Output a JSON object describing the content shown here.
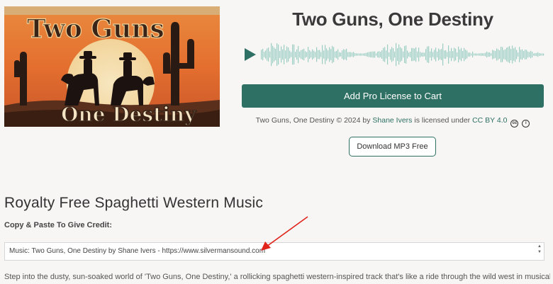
{
  "cover": {
    "title_line1": "Two Guns",
    "title_line2": "One Destiny"
  },
  "player": {
    "title": "Two Guns, One Destiny",
    "accent_color": "#2f7064",
    "waveform_color": "#9ccdc2",
    "play_icon": "play-icon"
  },
  "actions": {
    "cart_label": "Add Pro License to Cart",
    "download_label": "Download MP3 Free"
  },
  "license": {
    "prefix": "Two Guns, One Destiny © 2024 by",
    "author": "Shane Ivers",
    "middle": "is licensed under",
    "license_name": "CC BY 4.0",
    "cc_icon": "cc",
    "by_icon": "i"
  },
  "section": {
    "heading": "Royalty Free Spaghetti Western Music",
    "copy_label": "Copy & Paste To Give Credit:",
    "credit_text": "Music: Two Guns, One Destiny by Shane Ivers - https://www.silvermansound.com",
    "description": "Step into the dusty, sun-soaked world of 'Two Guns, One Destiny,' a rollicking spaghetti western-inspired track that's like a ride through the wild west in musical form."
  }
}
